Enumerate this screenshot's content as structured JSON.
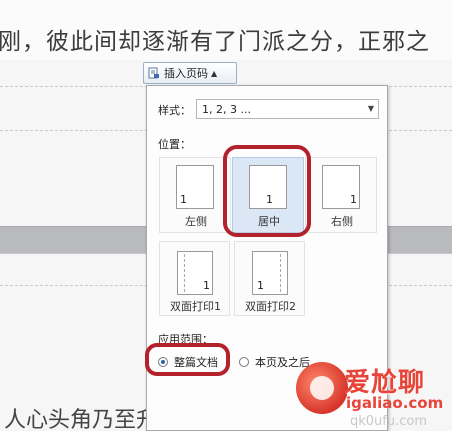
{
  "document": {
    "line_top": "刚，彼此间却逐渐有了门派之分，正邪之",
    "line_bottom": "人心头角乃至升华全然，在"
  },
  "toolbar": {
    "insert_page_number_label": "插入页码",
    "insert_icon": "page-number-icon"
  },
  "panel": {
    "style_label": "样式：",
    "style_value": "1, 2, 3 ...",
    "position_label": "位置：",
    "positions": [
      {
        "num": "1",
        "caption": "左侧"
      },
      {
        "num": "1",
        "caption": "居中"
      },
      {
        "num": "1",
        "caption": "右侧"
      },
      {
        "num": "1",
        "caption": "双面打印1"
      },
      {
        "num": "1",
        "caption": "双面打印2"
      }
    ],
    "selected_position": "居中",
    "scope_label": "应用范围：",
    "scope_options": [
      {
        "label": "整篇文档",
        "selected": true
      },
      {
        "label": "本页及之后",
        "selected": false
      }
    ]
  },
  "watermark": {
    "text": "爱尬聊",
    "url": "igaliao.com",
    "url2": "qk0ufu.com"
  },
  "colors": {
    "highlight": "#b3212b",
    "selected_bg": "#dbe7f5",
    "band": "#b8babd"
  }
}
